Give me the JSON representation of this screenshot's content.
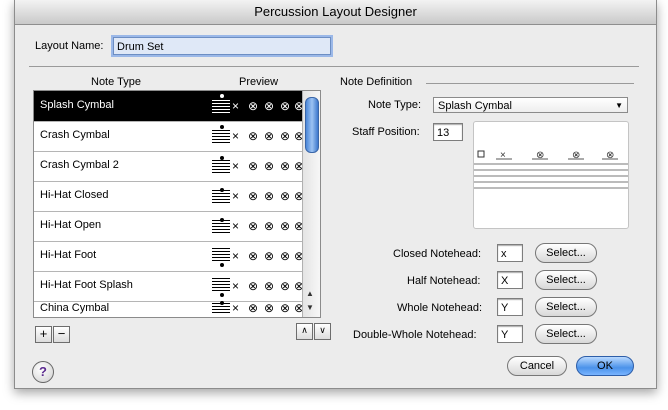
{
  "window": {
    "title": "Percussion Layout Designer"
  },
  "layout_name": {
    "label": "Layout Name:",
    "value": "Drum Set"
  },
  "list": {
    "header_note_type": "Note Type",
    "header_preview": "Preview",
    "items": [
      {
        "label": "Splash Cymbal",
        "selected": true
      },
      {
        "label": "Crash Cymbal",
        "selected": false
      },
      {
        "label": "Crash Cymbal 2",
        "selected": false
      },
      {
        "label": "Hi-Hat Closed",
        "selected": false
      },
      {
        "label": "Hi-Hat Open",
        "selected": false
      },
      {
        "label": "Hi-Hat Foot",
        "selected": false
      },
      {
        "label": "Hi-Hat Foot Splash",
        "selected": false
      },
      {
        "label": "China Cymbal",
        "selected": false
      }
    ],
    "preview_glyphs": [
      "×",
      "⊗",
      "⊗",
      "⊗",
      "⊗"
    ]
  },
  "note_definition": {
    "group_label": "Note Definition",
    "note_type_label": "Note Type:",
    "note_type_value": "Splash Cymbal",
    "staff_position_label": "Staff Position:",
    "staff_position_value": "13",
    "closed_notehead_label": "Closed Notehead:",
    "closed_notehead_value": "x",
    "half_notehead_label": "Half Notehead:",
    "half_notehead_value": "X",
    "whole_notehead_label": "Whole Notehead:",
    "whole_notehead_value": "Y",
    "double_whole_notehead_label": "Double-Whole Notehead:",
    "double_whole_notehead_value": "Y",
    "select_label": "Select..."
  },
  "buttons": {
    "cancel": "Cancel",
    "ok": "OK",
    "add": "+",
    "remove": "−",
    "help": "?"
  }
}
